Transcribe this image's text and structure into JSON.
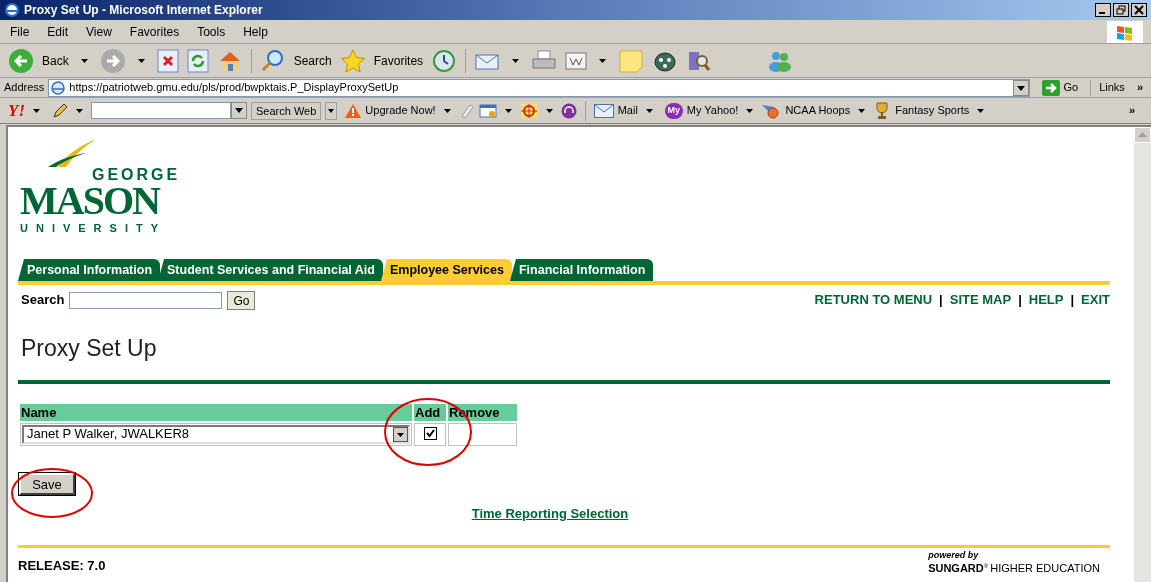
{
  "window": {
    "title": "Proxy Set Up - Microsoft Internet Explorer"
  },
  "menu": [
    "File",
    "Edit",
    "View",
    "Favorites",
    "Tools",
    "Help"
  ],
  "toolbar": {
    "back": "Back",
    "search": "Search",
    "favorites": "Favorites"
  },
  "address_bar": {
    "label": "Address",
    "url": "https://patriotweb.gmu.edu/pls/prod/bwpktais.P_DisplayProxySetUp",
    "go": "Go",
    "links": "Links",
    "more": "»"
  },
  "yahoo_bar": {
    "logo": "Y!",
    "search_button": "Search Web",
    "upgrade": "Upgrade Now!",
    "mail": "Mail",
    "my_badge": "My",
    "my_yahoo": "My Yahoo!",
    "ncaa": "NCAA Hoops",
    "fantasy": "Fantasy Sports",
    "more": "»"
  },
  "logo": {
    "top": "GEORGE",
    "main": "MASON",
    "bottom": "UNIVERSITY"
  },
  "tabs": [
    {
      "label": "Personal Information",
      "selected": false
    },
    {
      "label": "Student Services and Financial Aid",
      "selected": false
    },
    {
      "label": "Employee Services",
      "selected": true
    },
    {
      "label": "Financial Information",
      "selected": false
    }
  ],
  "search": {
    "label": "Search",
    "button": "Go"
  },
  "nav_links": [
    "RETURN TO MENU",
    "SITE MAP",
    "HELP",
    "EXIT"
  ],
  "nav_separator": "|",
  "heading": "Proxy Set Up",
  "table": {
    "columns": [
      "Name",
      "Add",
      "Remove"
    ],
    "rows": [
      {
        "name": "Janet P Walker, JWALKER8",
        "add_checked": true
      }
    ]
  },
  "save_button": "Save",
  "link": "Time Reporting Selection",
  "footer": {
    "release": "RELEASE: 7.0",
    "powered_by": "powered by",
    "brand": "SUNGARD",
    "brand_mark": "®",
    "brand_rest": "HIGHER EDUCATION"
  }
}
